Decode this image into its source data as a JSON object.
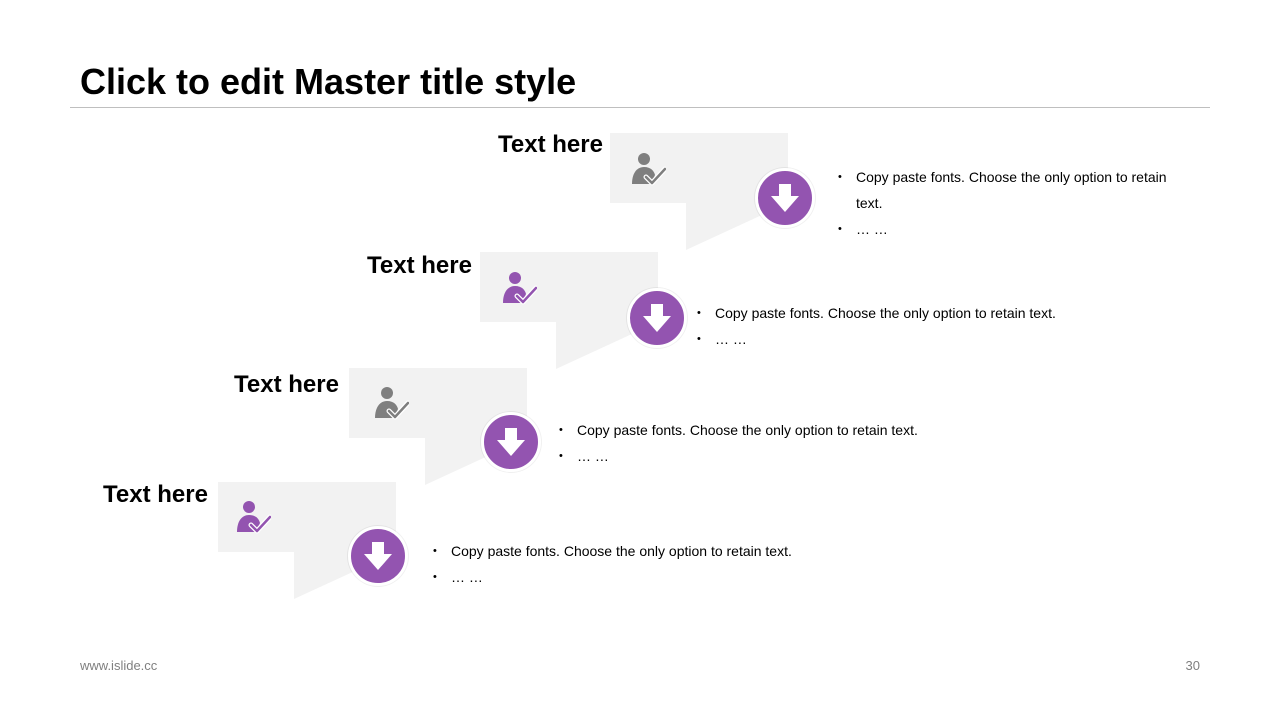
{
  "slide": {
    "title": "Click to edit Master title style"
  },
  "steps": [
    {
      "heading": "Text here",
      "icon": "person-check-icon",
      "icon_color": "#7f7f7f",
      "bullets": [
        "Copy paste fonts. Choose the only option to retain text.",
        "… …"
      ]
    },
    {
      "heading": "Text here",
      "icon": "person-check-icon",
      "icon_color": "#9354b0",
      "bullets": [
        "Copy paste fonts. Choose the only option to retain text.",
        "… …"
      ]
    },
    {
      "heading": "Text here",
      "icon": "person-check-icon",
      "icon_color": "#7f7f7f",
      "bullets": [
        "Copy paste fonts. Choose the only option to retain text.",
        "… …"
      ]
    },
    {
      "heading": "Text here",
      "icon": "person-check-icon",
      "icon_color": "#9354b0",
      "bullets": [
        "Copy paste fonts. Choose the only option to retain text.",
        "… …"
      ]
    }
  ],
  "colors": {
    "accent": "#9354b0",
    "box_fill": "#f2f2f2",
    "icon_gray": "#7f7f7f"
  },
  "arrow_icon": "arrow-down-icon",
  "footer": {
    "url": "www.islide.cc",
    "page_number": "30"
  }
}
